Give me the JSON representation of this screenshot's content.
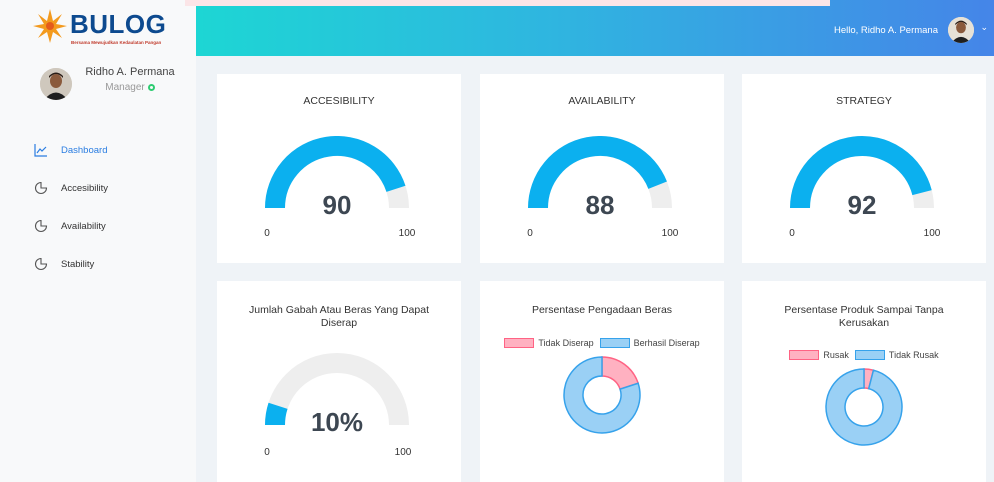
{
  "brand": {
    "name": "BULOG",
    "tagline": "Bersama Mewujudkan Kedaulatan Pangan"
  },
  "user": {
    "name": "Ridho A. Permana",
    "role": "Manager"
  },
  "header": {
    "greeting": "Hello, Ridho A. Permana"
  },
  "nav": [
    {
      "label": "Dashboard",
      "icon": "line-chart-icon",
      "active": true
    },
    {
      "label": "Accesibility",
      "icon": "gauge-icon",
      "active": false
    },
    {
      "label": "Availability",
      "icon": "gauge-icon",
      "active": false
    },
    {
      "label": "Stability",
      "icon": "gauge-icon",
      "active": false
    }
  ],
  "colors": {
    "accent": "#0bb0ef",
    "pink": "#ff6384",
    "blue": "#36a2eb"
  },
  "gauges": [
    {
      "title": "ACCESIBILITY",
      "value": 90,
      "display": "90",
      "min": "0",
      "max": "100"
    },
    {
      "title": "AVAILABILITY",
      "value": 88,
      "display": "88",
      "min": "0",
      "max": "100"
    },
    {
      "title": "STRATEGY",
      "value": 92,
      "display": "92",
      "min": "0",
      "max": "100"
    },
    {
      "title": "Jumlah Gabah Atau Beras Yang Dapat Diserap",
      "value": 10,
      "display": "10%",
      "min": "0",
      "max": "100"
    }
  ],
  "chart_data": [
    {
      "type": "pie",
      "title": "Persentase Pengadaan Beras",
      "labels": [
        "Tidak Diserap",
        "Berhasil Diserap"
      ],
      "values": [
        20,
        80
      ]
    },
    {
      "type": "pie",
      "title": "Persentase Produk Sampai Tanpa Kerusakan",
      "labels": [
        "Rusak",
        "Tidak Rusak"
      ],
      "values": [
        4,
        96
      ]
    }
  ]
}
